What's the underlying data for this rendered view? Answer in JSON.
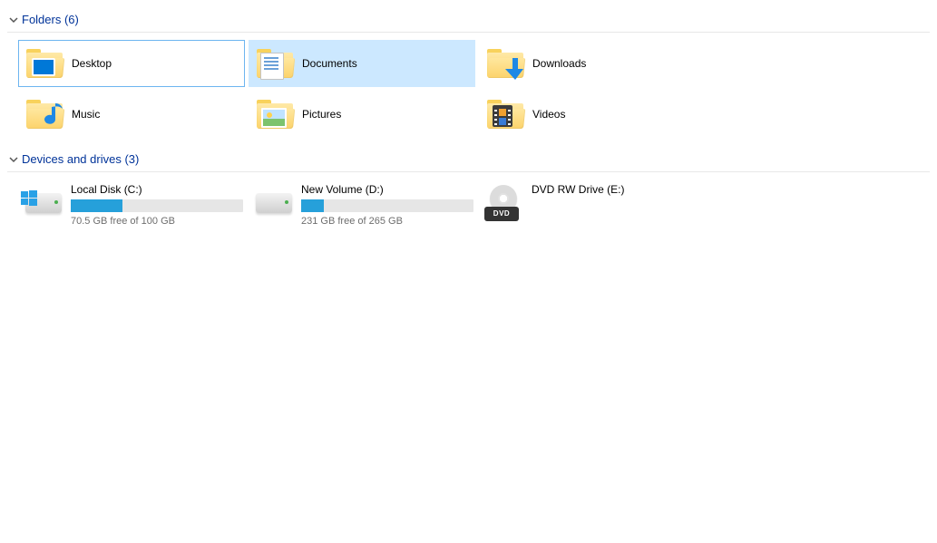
{
  "groups": {
    "folders": {
      "title": "Folders (6)",
      "items": [
        {
          "name": "Desktop",
          "icon": "desktop-folder",
          "state": "outlined"
        },
        {
          "name": "Documents",
          "icon": "documents-folder",
          "state": "highlighted"
        },
        {
          "name": "Downloads",
          "icon": "downloads-folder",
          "state": "normal"
        },
        {
          "name": "Music",
          "icon": "music-folder",
          "state": "normal"
        },
        {
          "name": "Pictures",
          "icon": "pictures-folder",
          "state": "normal"
        },
        {
          "name": "Videos",
          "icon": "videos-folder",
          "state": "normal"
        }
      ]
    },
    "drives": {
      "title": "Devices and drives (3)",
      "items": [
        {
          "name": "Local Disk (C:)",
          "status": "70.5 GB free of 100 GB",
          "used_pct": 30,
          "type": "os-disk"
        },
        {
          "name": "New Volume (D:)",
          "status": "231 GB free of 265 GB",
          "used_pct": 13,
          "type": "hdd"
        },
        {
          "name": "DVD RW Drive (E:)",
          "status": "",
          "used_pct": null,
          "type": "dvd",
          "case_label": "DVD"
        }
      ]
    }
  }
}
